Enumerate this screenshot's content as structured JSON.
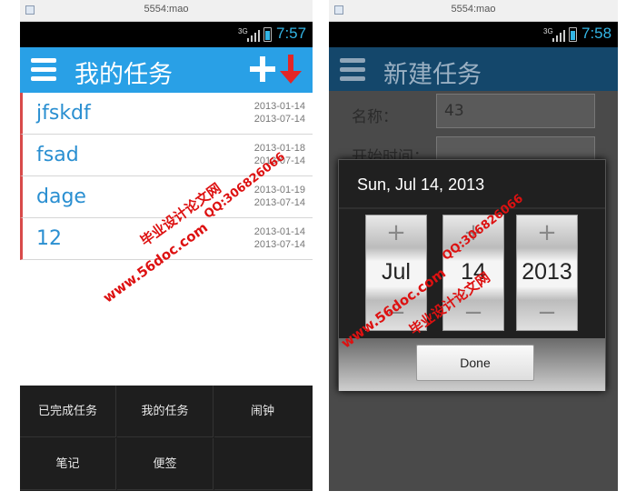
{
  "left_screen": {
    "window_title": "5554:mao",
    "status": {
      "network": "3G",
      "time": "7:57"
    },
    "action_bar": {
      "title": "我的任务"
    },
    "tasks": [
      {
        "name": "jfskdf",
        "date_start": "2013-01-14",
        "date_end": "2013-07-14"
      },
      {
        "name": "fsad",
        "date_start": "2013-01-18",
        "date_end": "2013-07-14"
      },
      {
        "name": "dage",
        "date_start": "2013-01-19",
        "date_end": "2013-07-14"
      },
      {
        "name": "12",
        "date_start": "2013-01-14",
        "date_end": "2013-07-14"
      }
    ],
    "bottom_menu": [
      "已完成任务",
      "我的任务",
      "闹钟",
      "笔记",
      "便签"
    ]
  },
  "right_screen": {
    "window_title": "5554:mao",
    "status": {
      "network": "3G",
      "time": "7:58"
    },
    "action_bar": {
      "title": "新建任务"
    },
    "form": {
      "name_label": "名称：",
      "name_value": "43",
      "start_label": "开始时间："
    },
    "date_dialog": {
      "title": "Sun, Jul 14, 2013",
      "month": "Jul",
      "day": "14",
      "year": "2013",
      "plus": "+",
      "minus": "−",
      "done_label": "Done"
    }
  },
  "watermarks": {
    "site_left": "www.56doc.com",
    "brand_left": "毕业设计论文网",
    "qq_left": "QQ:306826066",
    "site_right": "www.56doc.com",
    "brand_right": "毕业设计论文网",
    "qq_right": "QQ:306826066"
  },
  "colors": {
    "accent_blue": "#29a0e6",
    "task_text": "#2a8fd1",
    "row_marker": "#d84a4a",
    "watermark_red": "#dd1111"
  }
}
